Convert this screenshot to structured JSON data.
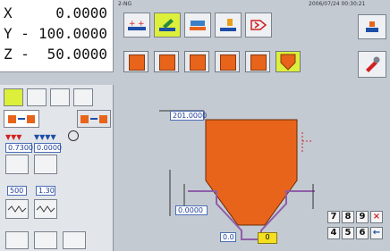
{
  "coords": [
    {
      "axis": "X",
      "value": "0.0000"
    },
    {
      "axis": "Y -",
      "value": "100.0000"
    },
    {
      "axis": "Z -",
      "value": "50.0000"
    }
  ],
  "header": {
    "left_label": "2-NG",
    "datetime": "2006/07/24  00:30:21"
  },
  "tools": {
    "selected_index": 1
  },
  "punches": {
    "selected_index": 5
  },
  "side": {
    "field_1": "0.7300",
    "field_2": "0.0000",
    "field_3": "500",
    "field_4": "1.30"
  },
  "main": {
    "width_label": "201.0000",
    "depth_label": "0.0000",
    "bottom_label": "0.0",
    "yellow_label": "0"
  },
  "keypad": {
    "row1": [
      "7",
      "8",
      "9",
      "×"
    ],
    "row2": [
      "4",
      "5",
      "6",
      "←"
    ]
  },
  "colors": {
    "accent": "#dcef3a",
    "punch": "#e8641a",
    "panel": "#c4cad2"
  }
}
